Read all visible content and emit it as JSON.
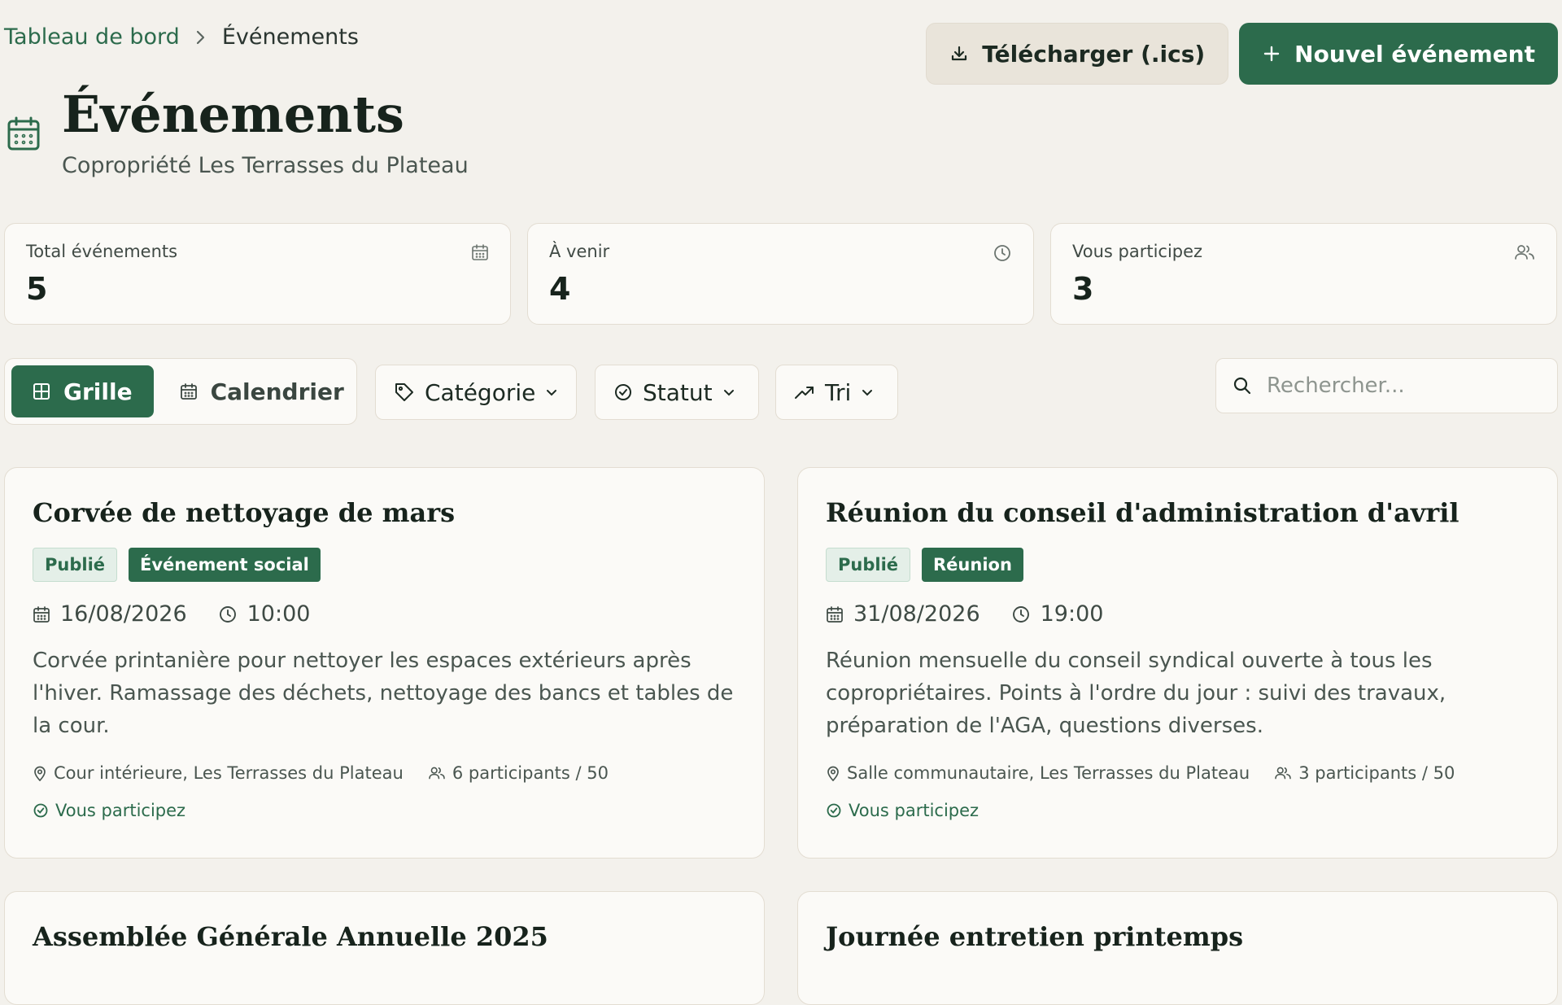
{
  "breadcrumb": {
    "parent": "Tableau de bord",
    "current": "Événements"
  },
  "actions": {
    "download_label": "Télécharger (.ics)",
    "new_label": "Nouvel événement"
  },
  "header": {
    "title": "Événements",
    "subtitle": "Copropriété Les Terrasses du Plateau"
  },
  "stats": [
    {
      "label": "Total événements",
      "value": "5",
      "icon": "calendar-icon"
    },
    {
      "label": "À venir",
      "value": "4",
      "icon": "clock-icon"
    },
    {
      "label": "Vous participez",
      "value": "3",
      "icon": "users-icon"
    }
  ],
  "toolbar": {
    "view_grid": "Grille",
    "view_calendar": "Calendrier",
    "filter_category": "Catégorie",
    "filter_status": "Statut",
    "filter_sort": "Tri",
    "search_placeholder": "Rechercher..."
  },
  "events": [
    {
      "title": "Corvée de nettoyage de mars",
      "status": "Publié",
      "category": "Événement social",
      "date": "16/08/2026",
      "time": "10:00",
      "description": "Corvée printanière pour nettoyer les espaces extérieurs après l'hiver. Ramassage des déchets, nettoyage des bancs et tables de la cour.",
      "location": "Cour intérieure, Les Terrasses du Plateau",
      "participants": "6 participants / 50",
      "participating": "Vous participez"
    },
    {
      "title": "Réunion du conseil d'administration d'avril",
      "status": "Publié",
      "category": "Réunion",
      "date": "31/08/2026",
      "time": "19:00",
      "description": "Réunion mensuelle du conseil syndical ouverte à tous les copropriétaires. Points à l'ordre du jour : suivi des travaux, préparation de l'AGA, questions diverses.",
      "location": "Salle communautaire, Les Terrasses du Plateau",
      "participants": "3 participants / 50",
      "participating": "Vous participez"
    },
    {
      "title": "Assemblée Générale Annuelle 2025"
    },
    {
      "title": "Journée entretien printemps"
    }
  ],
  "colors": {
    "primary": "#2c6b4c",
    "background": "#f3f1ec",
    "card": "#fbfaf7"
  }
}
